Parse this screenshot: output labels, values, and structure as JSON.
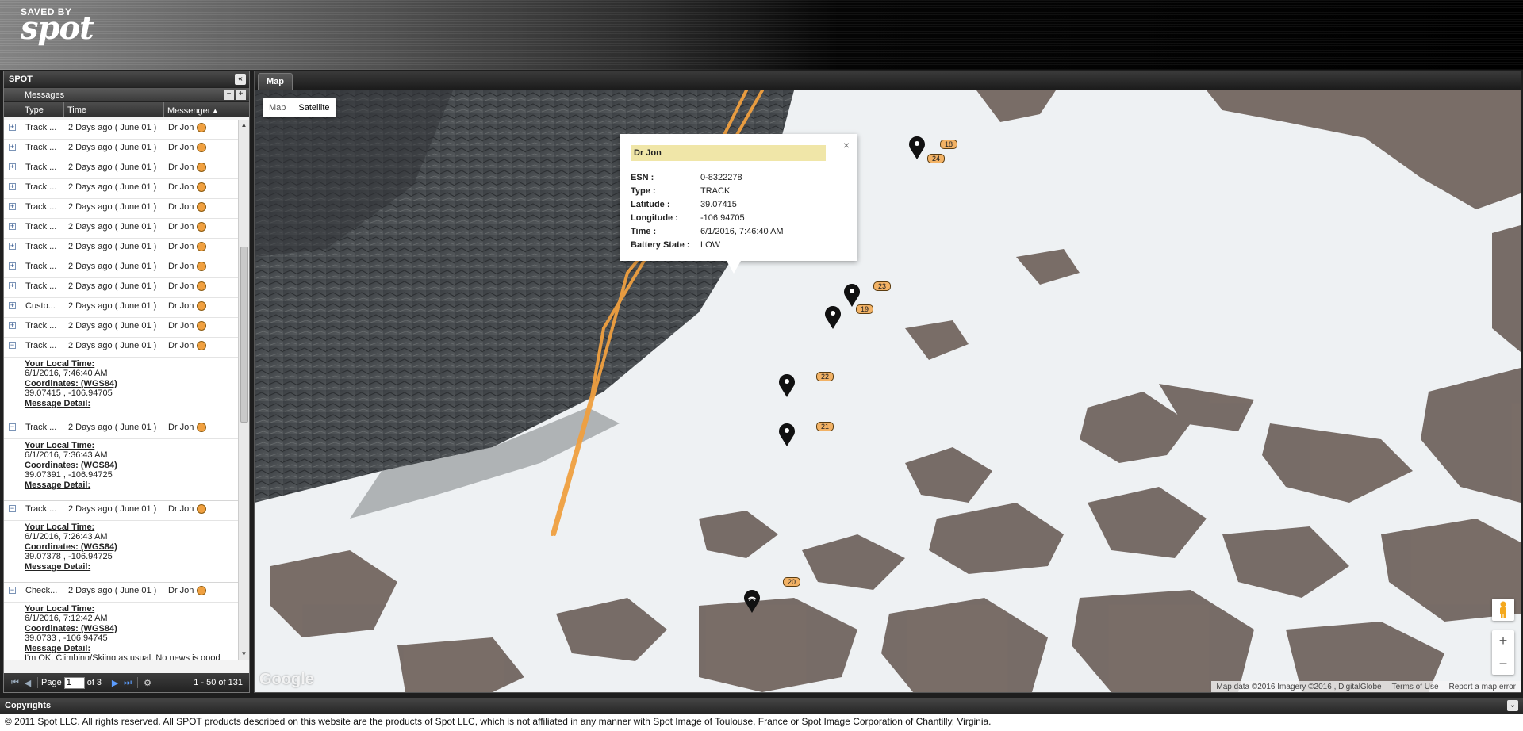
{
  "header": {
    "logo_top": "SAVED BY",
    "logo_main": "spot"
  },
  "left_panel": {
    "title": "SPOT",
    "collapse_icon": "«",
    "messages_title": "Messages",
    "columns": {
      "type": "Type",
      "time": "Time",
      "messenger": "Messenger ▴"
    },
    "rows": [
      {
        "type": "Track ...",
        "time": "2 Days ago ( June 01 )",
        "messenger": "Dr Jon"
      },
      {
        "type": "Track ...",
        "time": "2 Days ago ( June 01 )",
        "messenger": "Dr Jon"
      },
      {
        "type": "Track ...",
        "time": "2 Days ago ( June 01 )",
        "messenger": "Dr Jon"
      },
      {
        "type": "Track ...",
        "time": "2 Days ago ( June 01 )",
        "messenger": "Dr Jon"
      },
      {
        "type": "Track ...",
        "time": "2 Days ago ( June 01 )",
        "messenger": "Dr Jon"
      },
      {
        "type": "Track ...",
        "time": "2 Days ago ( June 01 )",
        "messenger": "Dr Jon"
      },
      {
        "type": "Track ...",
        "time": "2 Days ago ( June 01 )",
        "messenger": "Dr Jon"
      },
      {
        "type": "Track ...",
        "time": "2 Days ago ( June 01 )",
        "messenger": "Dr Jon"
      },
      {
        "type": "Track ...",
        "time": "2 Days ago ( June 01 )",
        "messenger": "Dr Jon"
      },
      {
        "type": "Custo...",
        "time": "2 Days ago ( June 01 )",
        "messenger": "Dr Jon"
      },
      {
        "type": "Track ...",
        "time": "2 Days ago ( June 01 )",
        "messenger": "Dr Jon"
      }
    ],
    "expanded": [
      {
        "type": "Track ...",
        "time": "2 Days ago ( June 01 )",
        "messenger": "Dr Jon",
        "local_time_label": "Your Local Time:",
        "local_time": "6/1/2016, 7:46:40 AM",
        "coords_label": "Coordinates: (WGS84)",
        "coords": "39.07415 , -106.94705",
        "detail_label": "Message Detail:",
        "detail": ""
      },
      {
        "type": "Track ...",
        "time": "2 Days ago ( June 01 )",
        "messenger": "Dr Jon",
        "local_time_label": "Your Local Time:",
        "local_time": "6/1/2016, 7:36:43 AM",
        "coords_label": "Coordinates: (WGS84)",
        "coords": "39.07391 , -106.94725",
        "detail_label": "Message Detail:",
        "detail": ""
      },
      {
        "type": "Track ...",
        "time": "2 Days ago ( June 01 )",
        "messenger": "Dr Jon",
        "local_time_label": "Your Local Time:",
        "local_time": "6/1/2016, 7:26:43 AM",
        "coords_label": "Coordinates: (WGS84)",
        "coords": "39.07378 , -106.94725",
        "detail_label": "Message Detail:",
        "detail": ""
      },
      {
        "type": "Check...",
        "time": "2 Days ago ( June 01 )",
        "messenger": "Dr Jon",
        "local_time_label": "Your Local Time:",
        "local_time": "6/1/2016, 7:12:42 AM",
        "coords_label": "Coordinates: (WGS84)",
        "coords": "39.0733 , -106.94745",
        "detail_label": "Message Detail:",
        "detail": "I'm OK. Climbing/Skiing as usual. No news is good"
      }
    ],
    "pager": {
      "page_label": "Page",
      "page_value": "1",
      "of_label": "of 3",
      "count": "1 - 50 of 131"
    }
  },
  "map_panel": {
    "tab": "Map",
    "map_types": [
      "Map",
      "Satellite"
    ],
    "info": {
      "title": "Dr Jon",
      "close": "×",
      "fields": [
        {
          "k": "ESN :",
          "v": "0-8322278"
        },
        {
          "k": "Type :",
          "v": "TRACK"
        },
        {
          "k": "Latitude :",
          "v": "39.07415"
        },
        {
          "k": "Longitude :",
          "v": "-106.94705"
        },
        {
          "k": "Time :",
          "v": "6/1/2016, 7:46:40 AM"
        },
        {
          "k": "Battery State :",
          "v": "LOW"
        }
      ]
    },
    "badges": [
      "18",
      "24",
      "23",
      "19",
      "22",
      "21",
      "20"
    ],
    "zoom": {
      "in": "+",
      "out": "−"
    },
    "google": "Google",
    "attribution": [
      "Map data ©2016 Imagery ©2016 , DigitalGlobe",
      "Terms of Use",
      "Report a map error"
    ]
  },
  "footer": {
    "title": "Copyrights",
    "text": "© 2011 Spot LLC. All rights reserved. All SPOT products described on this website are the products of Spot LLC, which is not affiliated in any manner with Spot Image of Toulouse, France or Spot Image Corporation of Chantilly, Virginia."
  },
  "colors": {
    "track": "#f0a040",
    "badge": "#f2b265",
    "info_title_bg": "#f0e6a8",
    "snow": "#eef1f3",
    "rock": "#6b5e58"
  }
}
